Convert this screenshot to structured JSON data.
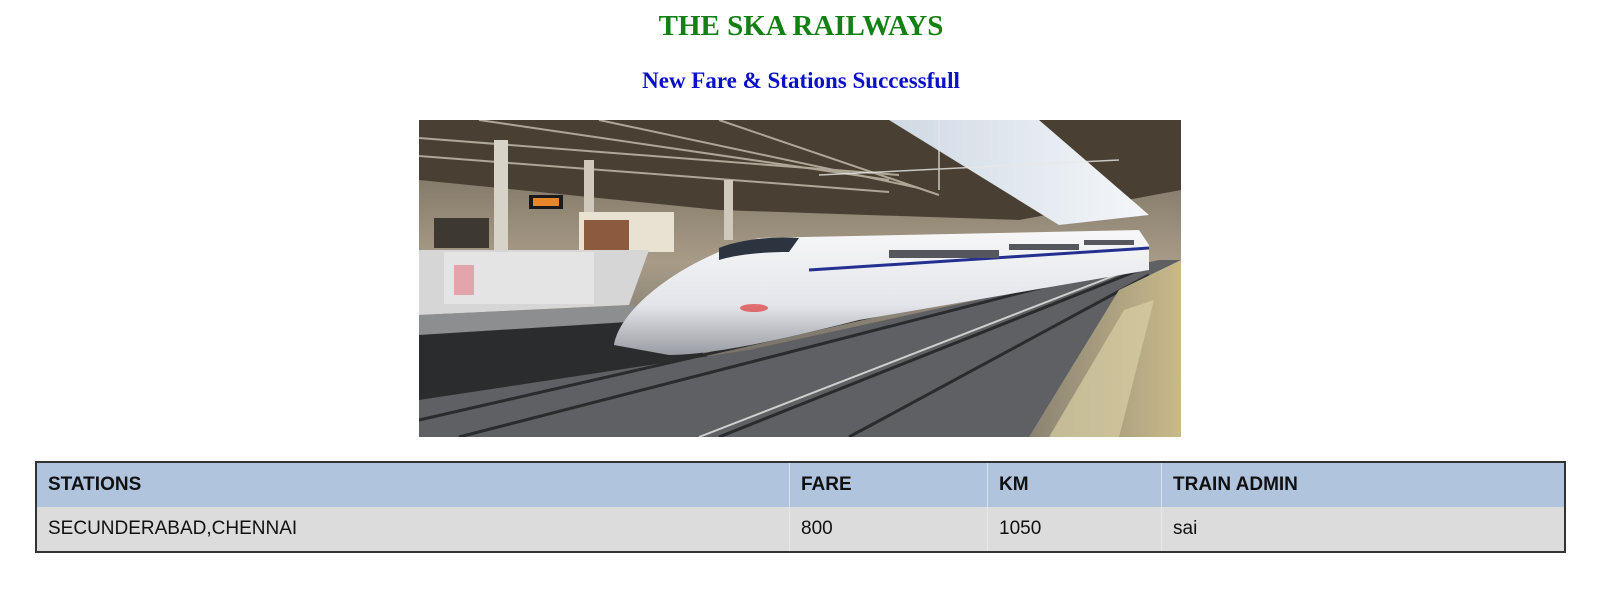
{
  "header": {
    "title": "THE SKA RAILWAYS",
    "subtitle": "New Fare & Stations Successfull"
  },
  "hero_image": {
    "subject": "bullet-train-at-station"
  },
  "table": {
    "columns": [
      "STATIONS",
      "FARE",
      "KM",
      "TRAIN ADMIN"
    ],
    "rows": [
      [
        "SECUNDERABAD,CHENNAI",
        "800",
        "1050",
        "sai"
      ]
    ]
  },
  "colors": {
    "title": "#138013",
    "subtitle": "#0a10c8",
    "table_header_bg": "#b0c4de",
    "table_row_bg": "#dcdcdc"
  }
}
